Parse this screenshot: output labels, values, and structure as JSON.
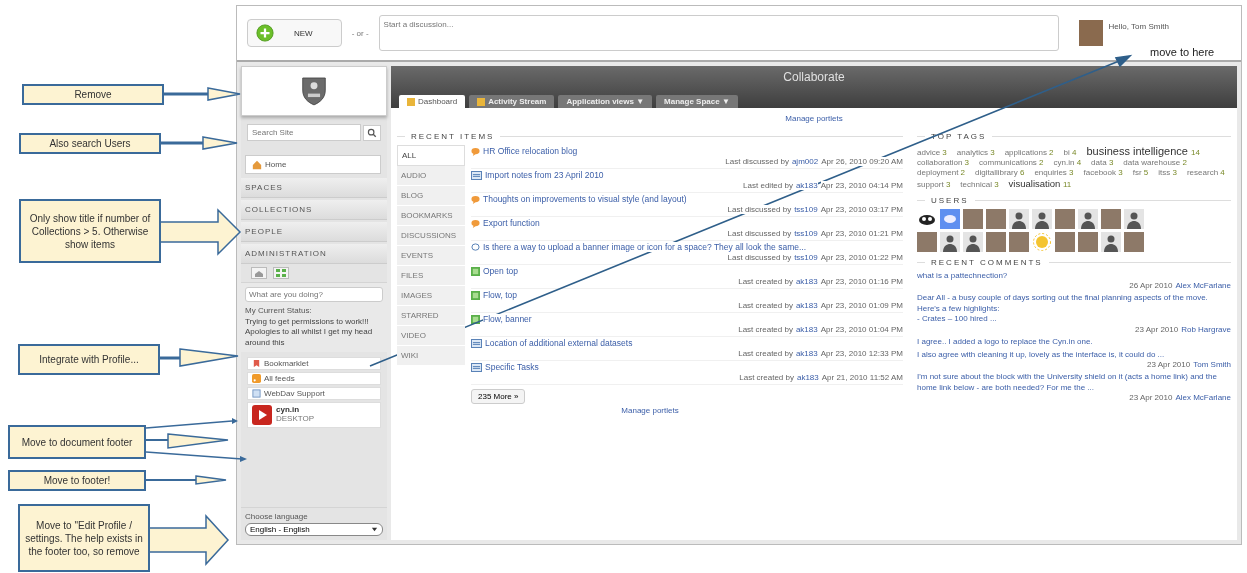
{
  "annotations": [
    {
      "text": "Remove"
    },
    {
      "text": "Also search Users"
    },
    {
      "text": "Only show title if number of Collections > 5. Otherwise show items"
    },
    {
      "text": "Integrate with Profile..."
    },
    {
      "text": "Move to document footer"
    },
    {
      "text": "Move to footer!"
    },
    {
      "text": "Move to \"Edit Profile / settings.  The help exists in the footer too, so remove"
    }
  ],
  "pointer_note": "move to here",
  "topbar": {
    "new_button": "NEW",
    "separator": "- or -",
    "discussion_placeholder": "Start a discussion...",
    "greeting": "Hello, Tom Smith"
  },
  "sidebar": {
    "search_placeholder": "Search Site",
    "home": "Home",
    "sections": [
      "SPACES",
      "COLLECTIONS",
      "PEOPLE",
      "ADMINISTRATION"
    ],
    "status_placeholder": "What are you doing?",
    "status_label": "My Current Status:",
    "status_text": "Trying to get permissions to work!!! Apologies to all whilst I get my head around this",
    "links": [
      {
        "label": "Bookmarklet",
        "kind": "bookmark"
      },
      {
        "label": "All feeds",
        "kind": "feed"
      },
      {
        "label": "WebDav Support",
        "kind": "webdav"
      }
    ],
    "desktop": {
      "name": "cyn.in",
      "subtitle": "DESKTOP"
    },
    "language_label": "Choose language",
    "language_value": "English - English"
  },
  "main": {
    "title": "Collaborate",
    "tabs": [
      {
        "label": "Dashboard",
        "selected": true
      },
      {
        "label": "Activity Stream",
        "selected": false
      },
      {
        "label": "Application views ▼",
        "selected": false
      },
      {
        "label": "Manage Space ▼",
        "selected": false
      }
    ],
    "manage_portlets_top": "Manage portlets",
    "recent_items": {
      "title": "RECENT ITEMS",
      "filters": [
        {
          "label": "ALL",
          "selected": true
        },
        {
          "label": "AUDIO",
          "selected": false
        },
        {
          "label": "BLOG",
          "selected": false
        },
        {
          "label": "BOOKMARKS",
          "selected": false
        },
        {
          "label": "DISCUSSIONS",
          "selected": false
        },
        {
          "label": "EVENTS",
          "selected": false
        },
        {
          "label": "FILES",
          "selected": false
        },
        {
          "label": "IMAGES",
          "selected": false
        },
        {
          "label": "STARRED",
          "selected": false
        },
        {
          "label": "VIDEO",
          "selected": false
        },
        {
          "label": "WIKI",
          "selected": false
        }
      ],
      "items": [
        {
          "kind": "discussion",
          "title": "HR Office relocation blog",
          "action": "Last discussed by",
          "user": "ajm002",
          "date": "Apr 26, 2010 09:20 AM"
        },
        {
          "kind": "document",
          "title": "Import notes from 23 April 2010",
          "action": "Last edited by",
          "user": "ak183",
          "date": "Apr 23, 2010 04:14 PM"
        },
        {
          "kind": "discussion",
          "title": "Thoughts on improvements to visual style (and layout)",
          "action": "Last discussed by",
          "user": "tss109",
          "date": "Apr 23, 2010 03:17 PM"
        },
        {
          "kind": "discussion",
          "title": "Export function",
          "action": "Last discussed by",
          "user": "tss109",
          "date": "Apr 23, 2010 01:21 PM"
        },
        {
          "kind": "question",
          "title": "Is there a way to upload a banner image or icon for a space? They all look the same...",
          "action": "Last discussed by",
          "user": "tss109",
          "date": "Apr 23, 2010 01:22 PM"
        },
        {
          "kind": "image",
          "title": "Open top",
          "action": "Last created by",
          "user": "ak183",
          "date": "Apr 23, 2010 01:16 PM"
        },
        {
          "kind": "image",
          "title": "Flow, top",
          "action": "Last created by",
          "user": "ak183",
          "date": "Apr 23, 2010 01:09 PM"
        },
        {
          "kind": "image",
          "title": "Flow, banner",
          "action": "Last created by",
          "user": "ak183",
          "date": "Apr 23, 2010 01:04 PM"
        },
        {
          "kind": "document",
          "title": "Location of additional external datasets",
          "action": "Last created by",
          "user": "ak183",
          "date": "Apr 23, 2010 12:33 PM"
        },
        {
          "kind": "document",
          "title": "Specific Tasks",
          "action": "Last created by",
          "user": "ak183",
          "date": "Apr 21, 2010 11:52 AM"
        }
      ],
      "more_button": "235 More »"
    },
    "manage_portlets_bottom": "Manage portlets",
    "top_tags": {
      "title": "TOP TAGS",
      "tags": [
        {
          "name": "advice",
          "count": "3",
          "kind": "small"
        },
        {
          "name": "analytics",
          "count": "3",
          "kind": "small"
        },
        {
          "name": "applications",
          "count": "2",
          "kind": "small"
        },
        {
          "name": "bi",
          "count": "4",
          "kind": "small"
        },
        {
          "name": "business intelligence",
          "count": "14",
          "kind": "large"
        },
        {
          "name": "collaboration",
          "count": "3",
          "kind": "small"
        },
        {
          "name": "communications",
          "count": "2",
          "kind": "small"
        },
        {
          "name": "cyn.in",
          "count": "4",
          "kind": "small"
        },
        {
          "name": "data",
          "count": "3",
          "kind": "small"
        },
        {
          "name": "data warehouse",
          "count": "2",
          "kind": "small"
        },
        {
          "name": "deployment",
          "count": "2",
          "kind": "small"
        },
        {
          "name": "digitallibrary",
          "count": "6",
          "kind": "small"
        },
        {
          "name": "enquiries",
          "count": "3",
          "kind": "small"
        },
        {
          "name": "facebook",
          "count": "3",
          "kind": "small"
        },
        {
          "name": "fsr",
          "count": "5",
          "kind": "small"
        },
        {
          "name": "itss",
          "count": "3",
          "kind": "small"
        },
        {
          "name": "research",
          "count": "4",
          "kind": "small"
        },
        {
          "name": "support",
          "count": "3",
          "kind": "small"
        },
        {
          "name": "technical",
          "count": "3",
          "kind": "small"
        },
        {
          "name": "visualisation",
          "count": "11",
          "kind": "medium"
        }
      ]
    },
    "users": {
      "title": "USERS",
      "avatars": [
        {
          "kind": "emblem"
        },
        {
          "kind": "cloud"
        },
        {
          "kind": "photo"
        },
        {
          "kind": "photo"
        },
        {
          "kind": "silhouette"
        },
        {
          "kind": "silhouette"
        },
        {
          "kind": "photo"
        },
        {
          "kind": "silhouette"
        },
        {
          "kind": "photo"
        },
        {
          "kind": "silhouette"
        },
        {
          "kind": "photo"
        },
        {
          "kind": "silhouette"
        },
        {
          "kind": "silhouette"
        },
        {
          "kind": "photo"
        },
        {
          "kind": "photo"
        },
        {
          "kind": "sun"
        },
        {
          "kind": "photo"
        },
        {
          "kind": "photo"
        },
        {
          "kind": "silhouette"
        },
        {
          "kind": "photo"
        }
      ]
    },
    "recent_comments": {
      "title": "RECENT COMMENTS",
      "comments": [
        {
          "lines": [
            "what is a pattechnection?"
          ],
          "date": "26 Apr 2010",
          "author": "Alex McFarlane"
        },
        {
          "lines": [
            "Dear All - a busy couple of days sorting out the final planning aspects of the move. Here's a few highlights:",
            "- Crates – 100 hired ..."
          ],
          "date": "23 Apr 2010",
          "author": "Rob Hargrave"
        },
        {
          "lines": [
            "I agree.. I added a logo to replace the Cyn.in one."
          ]
        },
        {
          "lines": [
            "I also agree with cleaning it up, lovely as the interface is, it could do ..."
          ],
          "date": "23 Apr 2010",
          "author": "Tom Smith"
        },
        {
          "lines": [
            "I'm not sure about the block with the University shield on it (acts a home link) and the home link below - are both needed? For me the ..."
          ],
          "date": "23 Apr 2010",
          "author": "Alex McFarlane"
        }
      ]
    }
  }
}
